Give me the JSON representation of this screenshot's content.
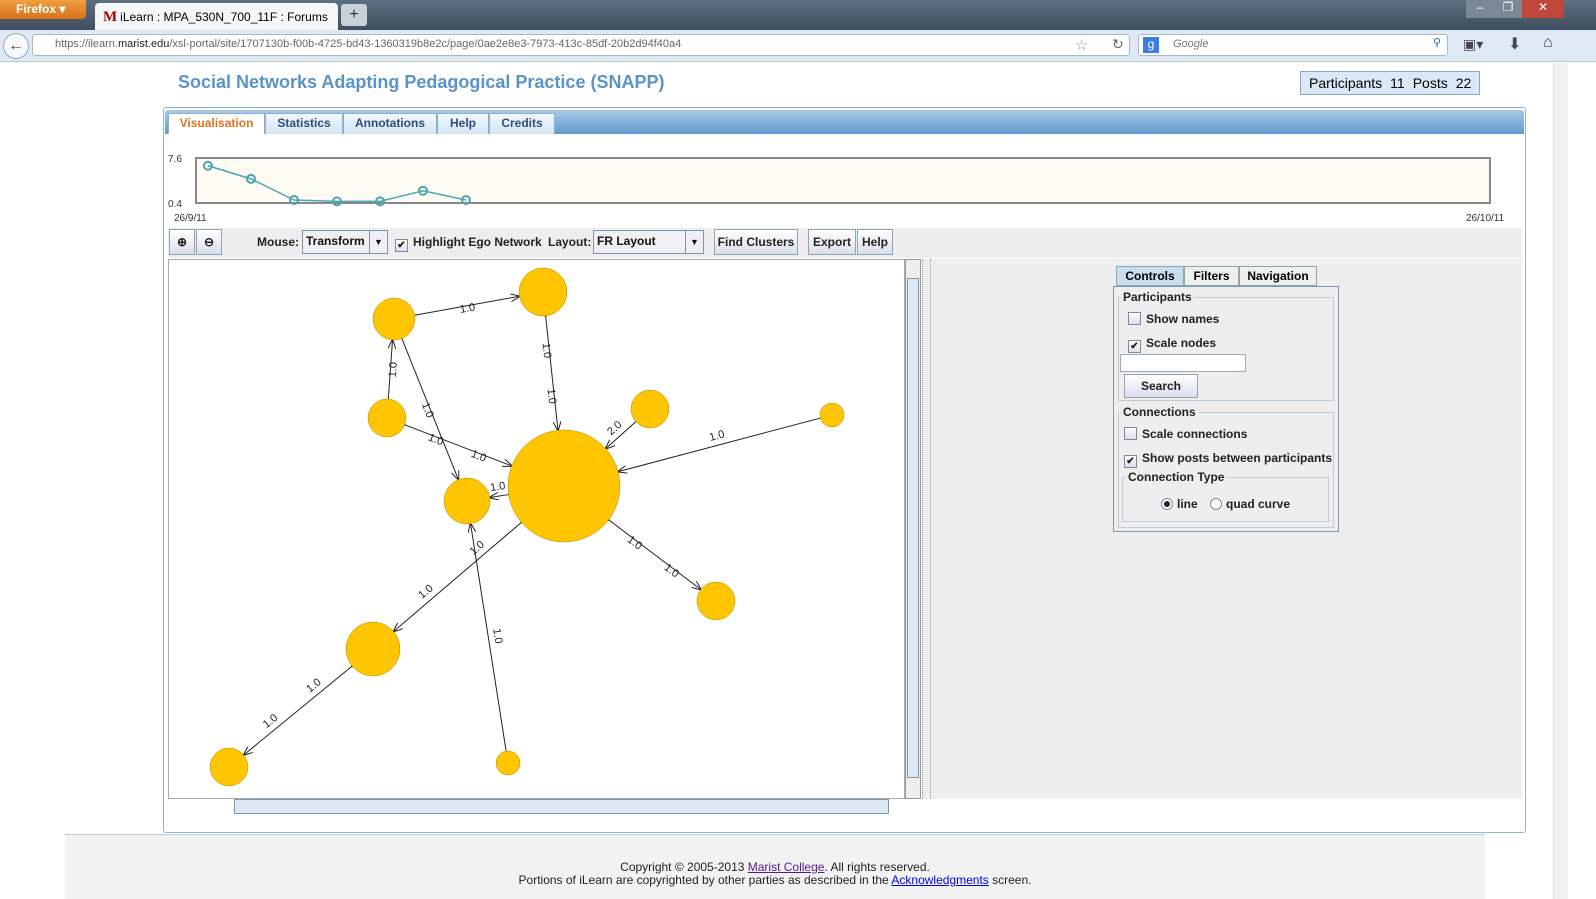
{
  "browser": {
    "menu_label": "Firefox",
    "tab_title": "iLearn : MPA_530N_700_11F : Forums",
    "tab_favicon": "M",
    "url_prefix": "https://ilearn.",
    "url_domain": "marist.edu",
    "url_rest": "/xsl-portal/site/1707130b-f00b-4725-bd43-1360319b8e2c/page/0ae2e8e3-7973-413c-85df-20b2d94f40a4",
    "search_placeholder": "Google"
  },
  "app": {
    "title": "Social Networks Adapting Pedagogical Practice (SNAPP)",
    "participants_label": "Participants",
    "participants": "11",
    "posts_label": "Posts",
    "posts": "22",
    "tabs": [
      {
        "label": "Visualisation",
        "selected": true
      },
      {
        "label": "Statistics"
      },
      {
        "label": "Annotations"
      },
      {
        "label": "Help"
      },
      {
        "label": "Credits"
      }
    ]
  },
  "chart_data": {
    "type": "line",
    "ylim": [
      0.4,
      7.6
    ],
    "y_ticks": [
      "7.6",
      "0.4"
    ],
    "x_start": "26/9/11",
    "x_end": "26/10/11",
    "values": [
      7.0,
      4.9,
      0.4,
      1.3,
      1.3,
      3.0,
      0.4
    ],
    "color": "#4aa6b0",
    "background": "#fdfbf2"
  },
  "toolbar": {
    "mouse_label": "Mouse:",
    "mouse_value": "Transform",
    "highlight_label": "Highlight Ego Network",
    "highlight_checked": true,
    "layout_label": "Layout:",
    "layout_value": "FR Layout",
    "find_clusters": "Find Clusters",
    "export": "Export",
    "help": "Help"
  },
  "graph": {
    "node_color": "#ffc500",
    "edges": [
      {
        "from": "A",
        "to": "B",
        "labels": [
          "1.0"
        ]
      },
      {
        "from": "B",
        "to": "F",
        "labels": [
          "1.0",
          "1.0"
        ]
      },
      {
        "from": "C",
        "to": "A",
        "labels": [
          "1.0"
        ]
      },
      {
        "from": "A",
        "to": "G",
        "labels": [
          "1.0"
        ]
      },
      {
        "from": "C",
        "to": "F",
        "labels": [
          "1.0",
          "1.0"
        ]
      },
      {
        "from": "D",
        "to": "F",
        "labels": [
          "2.0"
        ]
      },
      {
        "from": "E",
        "to": "F",
        "labels": [
          "1.0"
        ]
      },
      {
        "from": "F",
        "to": "G",
        "labels": [
          "1.0"
        ]
      },
      {
        "from": "F",
        "to": "H",
        "labels": [
          "1.0",
          "1.0"
        ]
      },
      {
        "from": "F",
        "to": "I",
        "labels": [
          "1.0",
          "1.0"
        ]
      },
      {
        "from": "I",
        "to": "J",
        "labels": [
          "1.0",
          "1.0"
        ]
      },
      {
        "from": "K",
        "to": "G",
        "labels": [
          "1.0"
        ]
      }
    ]
  },
  "panel": {
    "tabs": [
      "Controls",
      "Filters",
      "Navigation"
    ],
    "participants_group": "Participants",
    "show_names": "Show names",
    "show_names_checked": false,
    "scale_nodes": "Scale nodes",
    "scale_nodes_checked": true,
    "search_value": "",
    "search_button": "Search",
    "connections_group": "Connections",
    "scale_connections": "Scale connections",
    "scale_connections_checked": false,
    "show_posts": "Show posts between participants",
    "show_posts_checked": true,
    "connection_type_group": "Connection Type",
    "type_line": "line",
    "type_quad": "quad curve",
    "selected_type": "line"
  },
  "footer": {
    "copyright_pre": "Copyright © 2005-2013 ",
    "college_link": "Marist College",
    "copyright_post": ". All rights reserved.",
    "portions_pre": "Portions of iLearn are copyrighted by other parties as described in the ",
    "ack_link": "Acknowledgments",
    "portions_post": " screen."
  }
}
